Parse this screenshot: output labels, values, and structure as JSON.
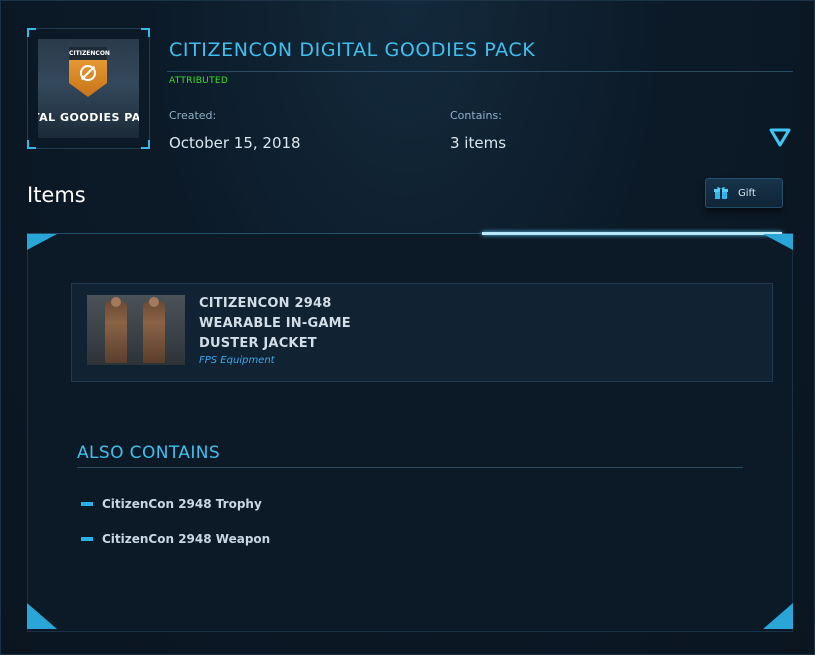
{
  "pledge": {
    "title": "CITIZENCON DIGITAL GOODIES PACK",
    "status": "ATTRIBUTED",
    "thumbnail": {
      "badge_text": "CITIZENCON",
      "caption": "TAL GOODIES PA"
    },
    "created_label": "Created:",
    "created_value": "October 15, 2018",
    "contains_label": "Contains:",
    "contains_value": "3 items",
    "expand_icon": "chevron-down-triangle-icon"
  },
  "items_section": {
    "heading": "Items",
    "gift_button": {
      "label": "Gift",
      "icon": "gift-box-icon"
    },
    "items": [
      {
        "name_lines": [
          "CITIZENCON 2948",
          "WEARABLE IN-GAME",
          "DUSTER JACKET"
        ],
        "type": "FPS Equipment"
      }
    ],
    "also_contains": {
      "heading": "ALSO CONTAINS",
      "entries": [
        "CitizenCon 2948 Trophy",
        "CitizenCon 2948 Weapon"
      ]
    }
  },
  "colors": {
    "accent": "#3fc0f0",
    "status_green": "#39e028",
    "background": "#0b1622"
  }
}
